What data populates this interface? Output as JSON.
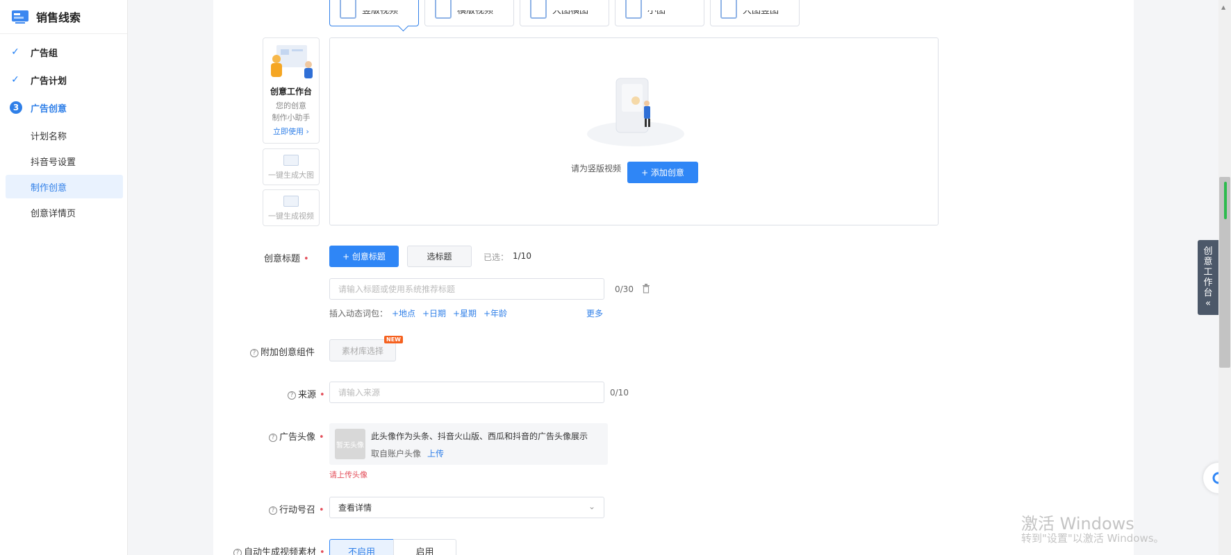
{
  "sidebar": {
    "title": "销售线索",
    "steps": [
      {
        "label": "广告组",
        "state": "done"
      },
      {
        "label": "广告计划",
        "state": "done"
      },
      {
        "label": "广告创意",
        "state": "active",
        "num": "3"
      }
    ],
    "subitems": [
      "计划名称",
      "抖音号设置",
      "制作创意",
      "创意详情页"
    ],
    "selected_subitem": "制作创意"
  },
  "format_tabs": [
    "竖版视频",
    "横版视频",
    "大图横图",
    "小图",
    "大图竖图"
  ],
  "helper": {
    "title": "创意工作台",
    "desc1": "您的创意",
    "desc2": "制作小助手",
    "link": "立即使用 ›",
    "gen_image": "一键生成大图",
    "gen_video": "一键生成视频"
  },
  "dropzone": {
    "hint": "请为竖版视频",
    "add_button": "+ 添加创意"
  },
  "title_section": {
    "label": "创意标题",
    "create_btn": "+ 创意标题",
    "select_btn": "选标题",
    "selected": "已选：",
    "selected_count": "1/10",
    "input_placeholder": "请输入标题或使用系统推荐标题",
    "input_counter": "0/30",
    "insert_label": "插入动态词包：",
    "words": [
      "+地点",
      "+日期",
      "+星期",
      "+年龄"
    ],
    "more": "更多"
  },
  "component": {
    "label": "附加创意组件",
    "button": "素材库选择",
    "badge": "NEW"
  },
  "source": {
    "label": "来源",
    "placeholder": "请输入来源",
    "counter": "0/10"
  },
  "avatar": {
    "label": "广告头像",
    "placeholder_img": "暂无头像",
    "desc": "此头像作为头条、抖音火山版、西瓜和抖音的广告头像展示",
    "from": "取自账户头像",
    "upload": "上传",
    "error": "请上传头像"
  },
  "cta": {
    "label": "行动号召",
    "value": "查看详情"
  },
  "auto_video": {
    "label": "自动生成视频素材",
    "options": [
      "不启用",
      "启用"
    ],
    "selected": "不启用"
  },
  "float_panel": "创意工作台«",
  "watermark": {
    "line1": "激活 Windows",
    "line2": "转到\"设置\"以激活 Windows。"
  },
  "colors": {
    "accent": "#2f86f6",
    "error": "#e34d59"
  }
}
